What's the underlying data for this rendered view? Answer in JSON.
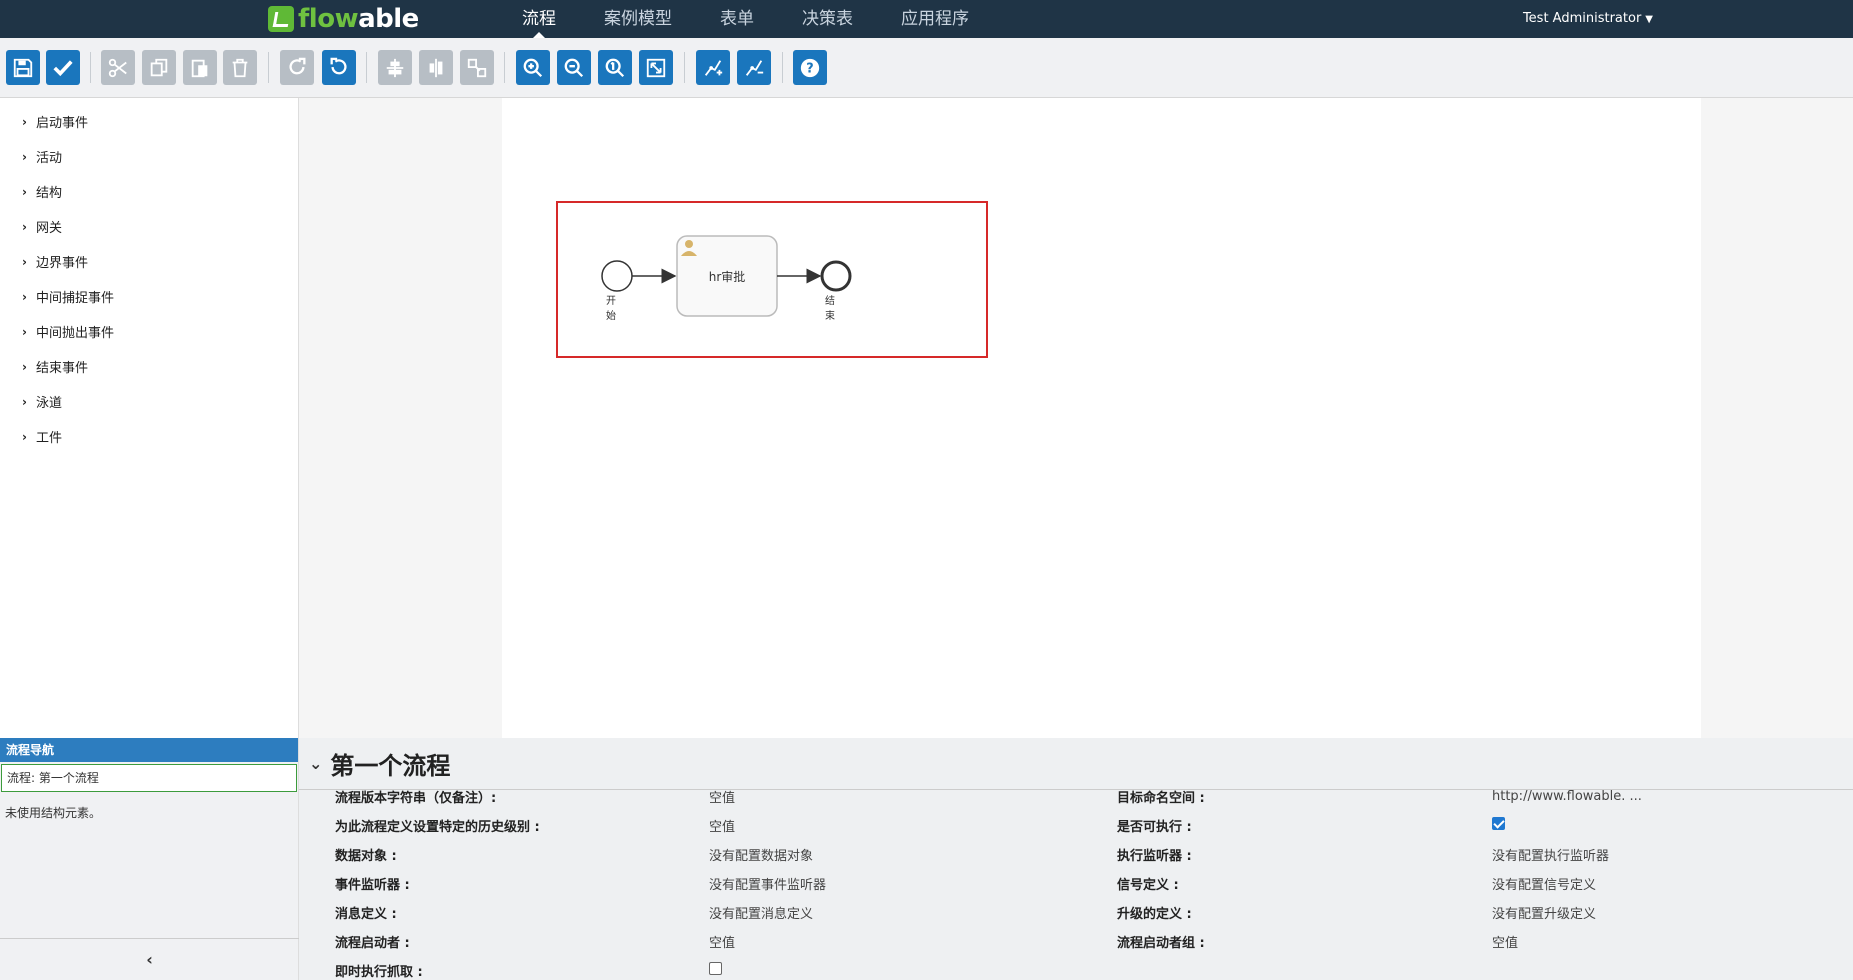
{
  "app": {
    "logo_text_a": "flow",
    "logo_text_b": "able"
  },
  "nav": {
    "tabs": [
      {
        "label": "流程",
        "active": true
      },
      {
        "label": "案例模型",
        "active": false
      },
      {
        "label": "表单",
        "active": false
      },
      {
        "label": "决策表",
        "active": false
      },
      {
        "label": "应用程序",
        "active": false
      }
    ],
    "user": "Test Administrator"
  },
  "toolbar": {
    "buttons": [
      {
        "name": "save-icon",
        "state": "blue"
      },
      {
        "name": "validate-icon",
        "state": "blue"
      },
      {
        "name": "cut-icon",
        "state": "grey"
      },
      {
        "name": "copy-icon",
        "state": "grey"
      },
      {
        "name": "paste-icon",
        "state": "grey"
      },
      {
        "name": "delete-icon",
        "state": "grey"
      },
      {
        "name": "redo-icon",
        "state": "grey"
      },
      {
        "name": "undo-icon",
        "state": "blue"
      },
      {
        "name": "align-horizontal-icon",
        "state": "grey"
      },
      {
        "name": "align-vertical-icon",
        "state": "grey"
      },
      {
        "name": "same-size-icon",
        "state": "grey"
      },
      {
        "name": "zoom-in-icon",
        "state": "blue"
      },
      {
        "name": "zoom-out-icon",
        "state": "blue"
      },
      {
        "name": "zoom-actual-icon",
        "state": "blue"
      },
      {
        "name": "zoom-fit-icon",
        "state": "blue"
      },
      {
        "name": "add-bendpoint-icon",
        "state": "blue"
      },
      {
        "name": "remove-bendpoint-icon",
        "state": "blue"
      },
      {
        "name": "help-icon",
        "state": "blue"
      }
    ]
  },
  "palette": {
    "items": [
      "启动事件",
      "活动",
      "结构",
      "网关",
      "边界事件",
      "中间捕捉事件",
      "中间抛出事件",
      "结束事件",
      "泳道",
      "工件"
    ]
  },
  "diagram": {
    "start_label": "开始",
    "task_label": "hr审批",
    "end_label": "结束",
    "task_icon": "user-icon"
  },
  "navigator": {
    "header": "流程导航",
    "row": "流程: 第一个流程",
    "note": "未使用结构元素。"
  },
  "properties": {
    "title": "第一个流程",
    "rows_left": [
      {
        "label": "流程版本字符串（仅备注）:",
        "value": "空值"
      },
      {
        "label": "为此流程定义设置特定的历史级别 :",
        "value": "空值"
      },
      {
        "label": "数据对象 :",
        "value": "没有配置数据对象"
      },
      {
        "label": "事件监听器 :",
        "value": "没有配置事件监听器"
      },
      {
        "label": "消息定义 :",
        "value": "没有配置消息定义"
      },
      {
        "label": "流程启动者 :",
        "value": "空值"
      },
      {
        "label": "即时执行抓取 :",
        "value": "",
        "checkbox": false
      }
    ],
    "rows_right": [
      {
        "label": "目标命名空间 :",
        "value": "http://www.flowable. ..."
      },
      {
        "label": "是否可执行 :",
        "value": "",
        "checkbox": true
      },
      {
        "label": "执行监听器 :",
        "value": "没有配置执行监听器"
      },
      {
        "label": "信号定义 :",
        "value": "没有配置信号定义"
      },
      {
        "label": "升级的定义 :",
        "value": "没有配置升级定义"
      },
      {
        "label": "流程启动者组 :",
        "value": "空值"
      }
    ]
  }
}
